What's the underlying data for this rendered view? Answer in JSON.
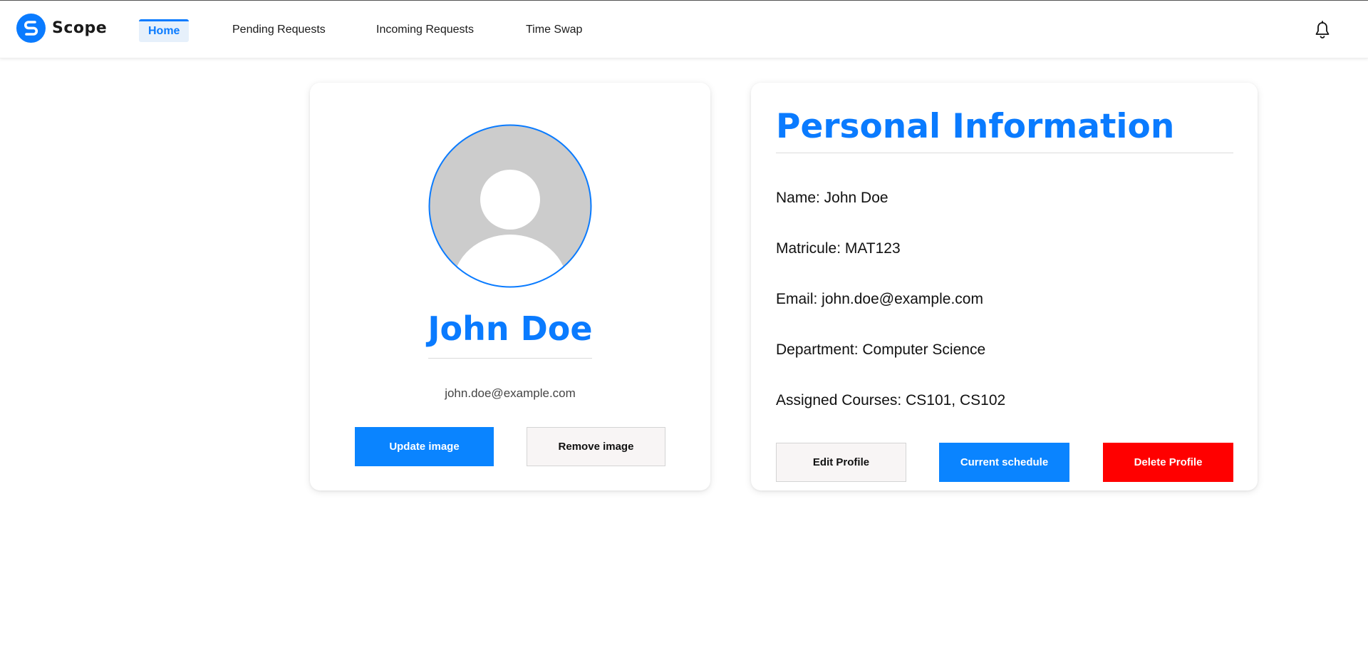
{
  "app": {
    "name": "Scope"
  },
  "nav": {
    "items": [
      {
        "label": "Home",
        "active": true
      },
      {
        "label": "Pending Requests",
        "active": false
      },
      {
        "label": "Incoming Requests",
        "active": false
      },
      {
        "label": "Time Swap",
        "active": false
      }
    ],
    "notification_icon": "bell-icon"
  },
  "profile": {
    "name": "John Doe",
    "email": "john.doe@example.com",
    "avatar_icon": "user-placeholder-icon",
    "update_image_label": "Update image",
    "remove_image_label": "Remove image"
  },
  "info": {
    "title": "Personal Information",
    "name_line": "Name: John Doe",
    "matricule_line": "Matricule: MAT123",
    "email_line": "Email: john.doe@example.com",
    "department_line": "Department: Computer Science",
    "courses_line": "Assigned Courses: CS101, CS102",
    "edit_label": "Edit Profile",
    "schedule_label": "Current schedule",
    "delete_label": "Delete Profile"
  },
  "colors": {
    "accent": "#0a7bff",
    "primary_button": "#0a84ff",
    "danger_button": "#ff0000",
    "avatar_bg": "#cccccc"
  }
}
